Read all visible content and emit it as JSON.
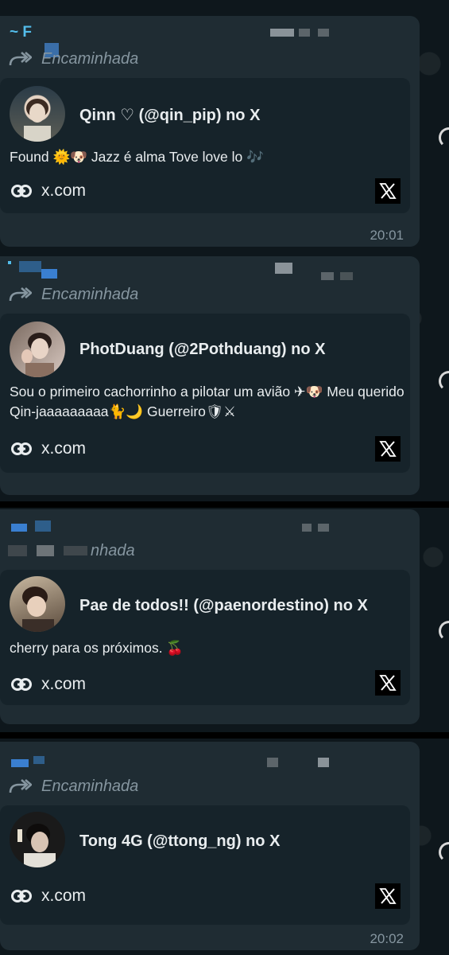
{
  "chat": {
    "messages": [
      {
        "sender": "~ F",
        "forwarded_label": "Encaminhada",
        "preview": {
          "title": "Qinn ♡ (@qin_pip) no X",
          "description": "Found 🌞🐶 Jazz é alma Tove love lo 🎶",
          "link": "x.com"
        },
        "time": "20:01"
      },
      {
        "sender": "",
        "forwarded_label": "Encaminhada",
        "preview": {
          "title": "PhotDuang (@2Pothduang) no X",
          "description": "Sou o primeiro cachorrinho a pilotar um avião ✈🐶 Meu querido Qin-jaaaaaaaaa🐈🌙 Guerreiro🛡⚔",
          "link": "x.com"
        },
        "time": ""
      },
      {
        "sender": "",
        "forwarded_label": "nhada",
        "preview": {
          "title": "Pae de todos!! (@paenordestino) no X",
          "description": "cherry para os próximos. 🍒",
          "link": "x.com"
        },
        "time": ""
      },
      {
        "sender": "",
        "forwarded_label": "Encaminhada",
        "preview": {
          "title": "Tong 4G (@ttong_ng) no X",
          "description": "",
          "link": "x.com"
        },
        "time": "20:02"
      }
    ]
  },
  "icons": {
    "forward": "forward-arrow-icon",
    "link": "link-icon",
    "x_logo": "x-logo-icon"
  },
  "colors": {
    "background": "#0b141a",
    "bubble": "#1f2c33",
    "card": "#16232a",
    "sender": "#53bdeb",
    "meta": "#8696a0"
  }
}
